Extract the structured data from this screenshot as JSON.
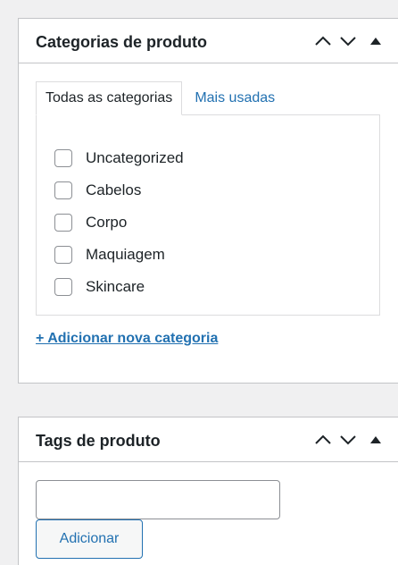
{
  "categories_panel": {
    "title": "Categorias de produto",
    "tabs": [
      {
        "label": "Todas as categorias",
        "active": true
      },
      {
        "label": "Mais usadas",
        "active": false
      }
    ],
    "items": [
      {
        "label": "Uncategorized",
        "checked": false
      },
      {
        "label": "Cabelos",
        "checked": false
      },
      {
        "label": "Corpo",
        "checked": false
      },
      {
        "label": "Maquiagem",
        "checked": false
      },
      {
        "label": "Skincare",
        "checked": false
      }
    ],
    "add_link": "+ Adicionar nova categoria"
  },
  "tags_panel": {
    "title": "Tags de produto",
    "input_value": "",
    "add_button": "Adicionar"
  },
  "icons": {
    "move_up": "chevron-up-icon",
    "move_down": "chevron-down-icon",
    "toggle": "triangle-up-icon"
  },
  "colors": {
    "link": "#2271b1",
    "border": "#c3c4c7",
    "background": "#f0f0f1",
    "text": "#1d2327"
  }
}
